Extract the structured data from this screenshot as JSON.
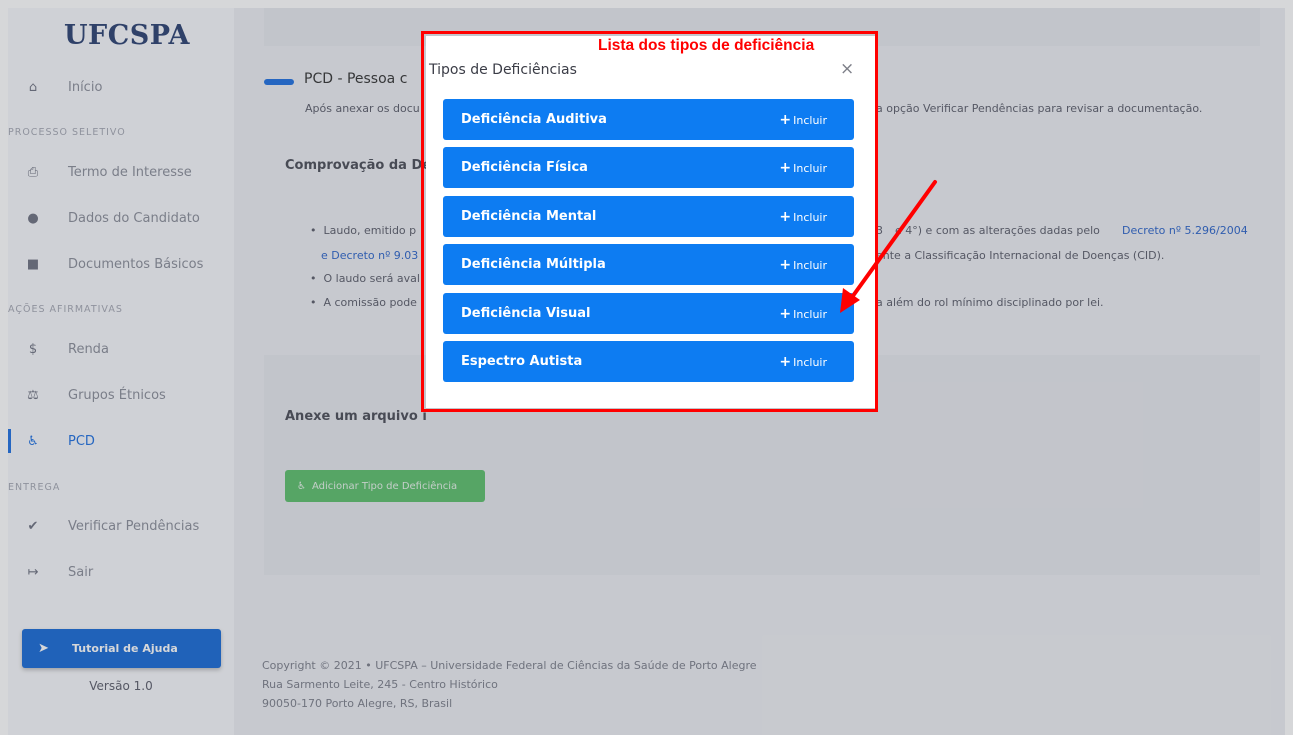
{
  "sidebar": {
    "logo": "UFCSPA",
    "inicio": "Início",
    "section_processo": "PROCESSO SELETIVO",
    "termo": "Termo de Interesse",
    "dados": "Dados do Candidato",
    "documentos": "Documentos Básicos",
    "section_acoes": "AÇÕES AFIRMATIVAS",
    "renda": "Renda",
    "grupos": "Grupos Étnicos",
    "pcd": "PCD",
    "section_entrega": "ENTREGA",
    "verificar": "Verificar Pendências",
    "sair": "Sair",
    "tutorial": "Tutorial de Ajuda",
    "versao": "Versão 1.0"
  },
  "main": {
    "title": "PCD - Pessoa c",
    "intro_left": "Após anexar os docu",
    "intro_right": "a opção Verificar Pendências para revisar a documentação.",
    "comprovacao": "Comprovação da De",
    "bullet1_left": "Laudo, emitido p",
    "bullet1_right_a": "3",
    "bullet1_right_b": "e 4°) e com as alterações dadas pelo",
    "bullet1_link": "Decreto nº 5.296/2004",
    "bullet2_link": "e Decreto nº 9.03",
    "bullet2_right": "ente a Classificação Internacional de Doenças (CID).",
    "bullet3": "O laudo será aval",
    "bullet4_left": "A comissão pode",
    "bullet4_right": "a além do rol mínimo disciplinado por lei.",
    "anexe": "Anexe um arquivo i",
    "add_button": "Adicionar Tipo de Deficiência"
  },
  "footer": {
    "line1": "Copyright © 2021  •  UFCSPA – Universidade Federal de Ciências da Saúde de Porto Alegre",
    "line2": "Rua Sarmento Leite, 245 - Centro Histórico",
    "line3": "90050-170 Porto Alegre, RS, Brasil"
  },
  "modal": {
    "title": "Tipos de Deficiências",
    "close": "×",
    "annotation": "Lista dos tipos de deficiência",
    "include_label": "Incluir",
    "items": [
      {
        "label": "Deficiência Auditiva"
      },
      {
        "label": "Deficiência Física"
      },
      {
        "label": "Deficiência Mental"
      },
      {
        "label": "Deficiência Múltipla"
      },
      {
        "label": "Deficiência Visual"
      },
      {
        "label": "Espectro Autista"
      }
    ]
  },
  "colors": {
    "primary": "#0d7cf2",
    "annotation": "#ff0000",
    "success": "#4cbb5d"
  }
}
